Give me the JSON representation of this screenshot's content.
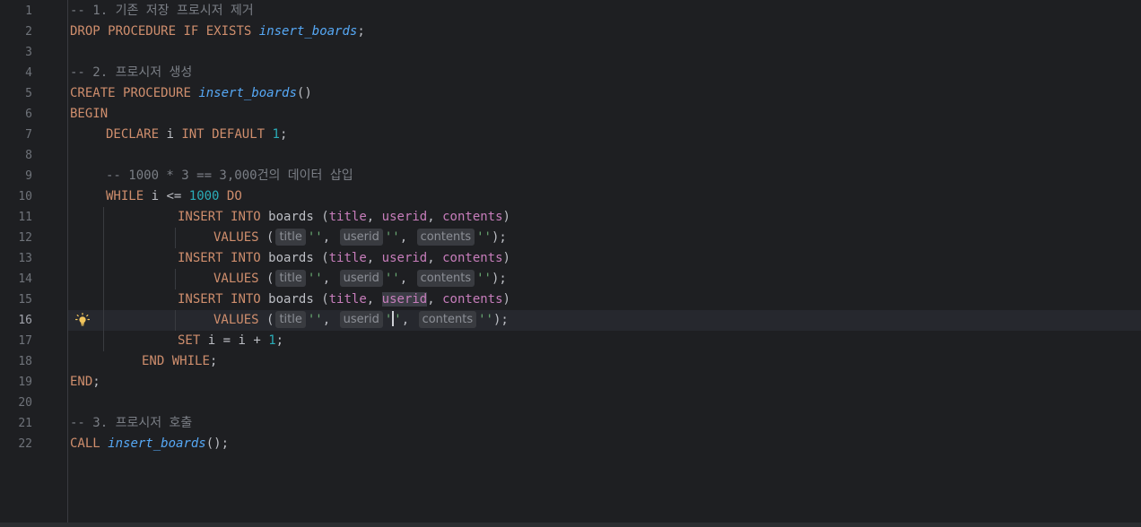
{
  "editor": {
    "current_line": 16,
    "line_numbers": [
      "1",
      "2",
      "3",
      "4",
      "5",
      "6",
      "7",
      "8",
      "9",
      "10",
      "11",
      "12",
      "13",
      "14",
      "15",
      "16",
      "17",
      "18",
      "19",
      "20",
      "21",
      "22"
    ],
    "colors": {
      "background": "#1e1f22",
      "keyword": "#cf8e6d",
      "comment": "#7a7e85",
      "function": "#56a8f5",
      "number": "#2aacb8",
      "string": "#6aab73",
      "column": "#c77dbb"
    },
    "icons": {
      "intention": "lightbulb-icon"
    },
    "tokens": {
      "c1": "-- 1. 기존 저장 프로시저 제거",
      "drop": "DROP",
      "procedure": "PROCEDURE",
      "if": "IF",
      "exists": "EXISTS",
      "fn_name": "insert_boards",
      "semi": ";",
      "c2": "-- 2. 프로시저 생성",
      "create": "CREATE",
      "parens": "()",
      "begin": "BEGIN",
      "declare": "DECLARE",
      "var_i": "i",
      "int": "INT",
      "default": "DEFAULT",
      "one": "1",
      "c3": "-- 1000 * 3 == 3,000건의 데이터 삽입",
      "while": "WHILE",
      "lte": "<=",
      "thousand": "1000",
      "do": "DO",
      "insert": "INSERT",
      "into": "INTO",
      "boards": "boards",
      "open_paren": "(",
      "close_paren": ")",
      "comma": ",",
      "col_title": "title",
      "col_userid": "userid",
      "col_contents": "contents",
      "values": "VALUES",
      "empty_str": "''",
      "quote": "'",
      "end_paren_semi": ");",
      "hint_title": "title",
      "hint_userid": "userid",
      "hint_contents": "contents",
      "set": "SET",
      "eq": "=",
      "plus": "+",
      "end": "END",
      "c4": "-- 3. 프로시저 호출",
      "call": "CALL",
      "call_end": "();"
    }
  }
}
